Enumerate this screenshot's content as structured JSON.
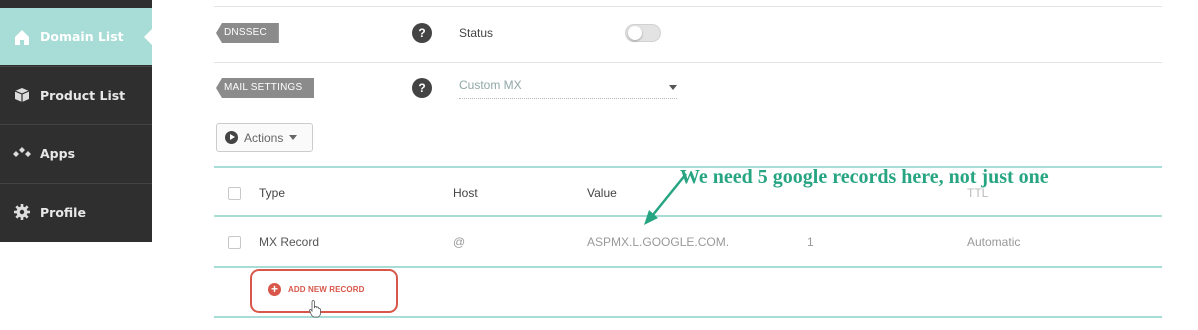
{
  "sidebar": {
    "items": [
      {
        "label": "Domain List",
        "icon": "home-icon",
        "active": true
      },
      {
        "label": "Product List",
        "icon": "box-icon",
        "active": false
      },
      {
        "label": "Apps",
        "icon": "diamonds-icon",
        "active": false
      },
      {
        "label": "Profile",
        "icon": "gear-icon",
        "active": false
      }
    ]
  },
  "dnssec": {
    "tag": "DNSSEC",
    "help": "?",
    "label": "Status",
    "toggle_on": false
  },
  "mail_settings": {
    "tag": "MAIL SETTINGS",
    "help": "?",
    "selected": "Custom MX"
  },
  "actions": {
    "label": "Actions"
  },
  "table": {
    "headers": [
      "Type",
      "Host",
      "Value",
      "TTL"
    ],
    "rows": [
      {
        "type": "MX Record",
        "host": "@",
        "value": "ASPMX.L.GOOGLE.COM.",
        "priority": "1",
        "ttl": "Automatic"
      }
    ]
  },
  "add_record": {
    "label": "ADD NEW RECORD"
  },
  "annotation": {
    "text": "We need 5 google records here, not just one"
  },
  "colors": {
    "accent": "#a8dcd7",
    "sidebar": "#2f2f2f",
    "highlight": "#d9574a",
    "annotation": "#27a583"
  }
}
